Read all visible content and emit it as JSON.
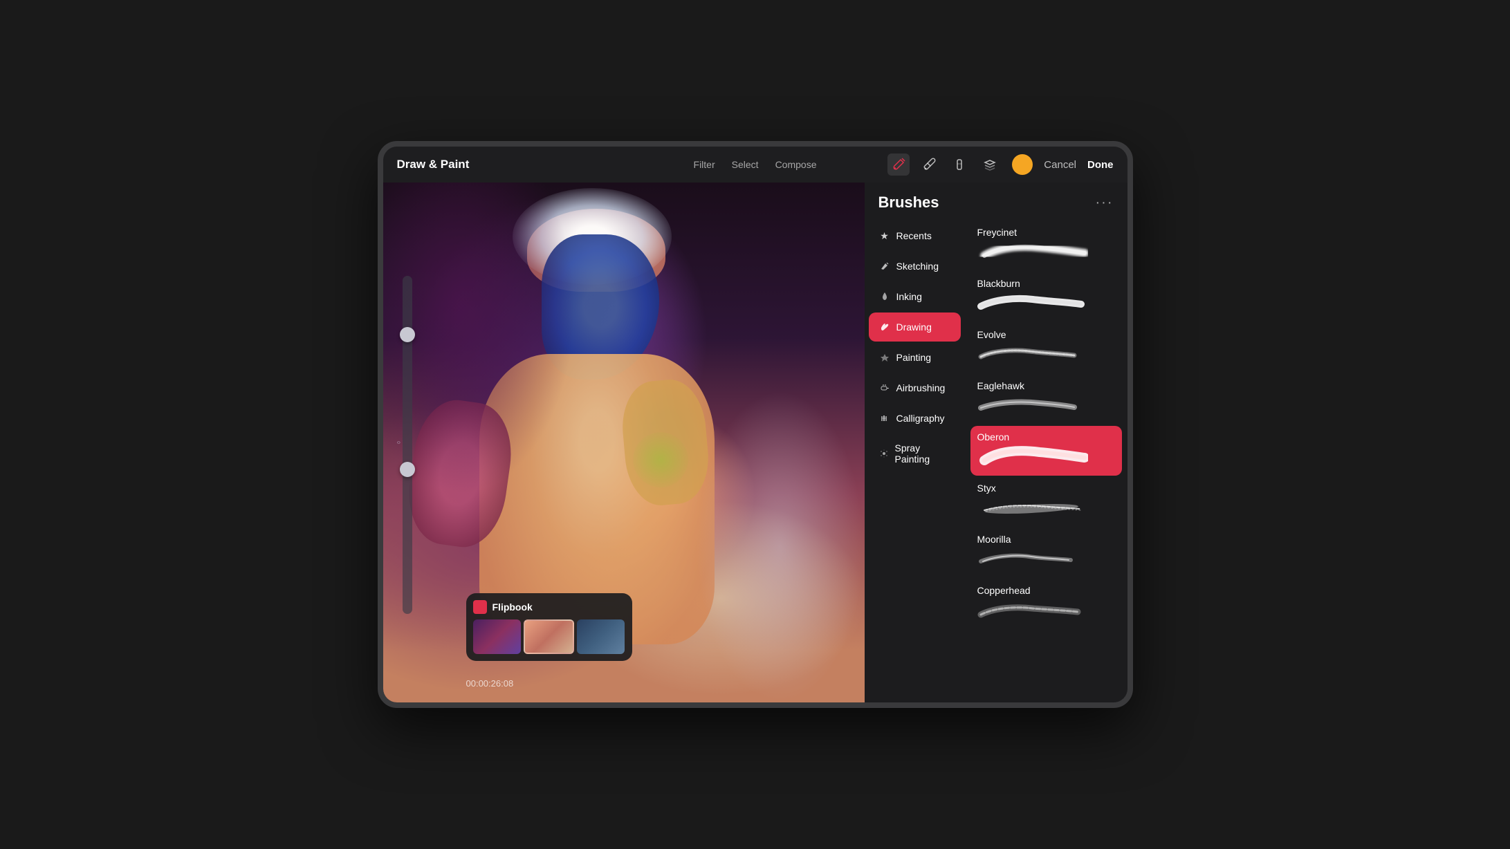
{
  "app": {
    "title": "Draw & Paint",
    "cancel_label": "Cancel",
    "done_label": "Done"
  },
  "toolbar": {
    "nav_items": [
      "Filter",
      "Select",
      "Compose"
    ],
    "tools": [
      "brush-tool",
      "eyedropper-tool",
      "pencil-tool",
      "layers-tool"
    ]
  },
  "canvas": {
    "timestamp": "00:00:26:08"
  },
  "flipbook": {
    "title": "Flipbook",
    "icon_color": "#e0304a"
  },
  "brushes": {
    "title": "Brushes",
    "more_label": "···",
    "categories": [
      {
        "id": "recents",
        "label": "Recents",
        "icon": "★",
        "active": false
      },
      {
        "id": "sketching",
        "label": "Sketching",
        "icon": "✏",
        "active": false
      },
      {
        "id": "inking",
        "label": "Inking",
        "icon": "💧",
        "active": false
      },
      {
        "id": "drawing",
        "label": "Drawing",
        "icon": "✦",
        "active": true
      },
      {
        "id": "painting",
        "label": "Painting",
        "icon": "◆",
        "active": false
      },
      {
        "id": "airbrushing",
        "label": "Airbrushing",
        "icon": "≋",
        "active": false
      },
      {
        "id": "calligraphy",
        "label": "Calligraphy",
        "icon": "|||",
        "active": false
      },
      {
        "id": "spray-painting",
        "label": "Spray Painting",
        "icon": "✳",
        "active": false
      }
    ],
    "brushes": [
      {
        "id": "freycinet",
        "name": "Freycinet",
        "selected": false
      },
      {
        "id": "blackburn",
        "name": "Blackburn",
        "selected": false
      },
      {
        "id": "evolve",
        "name": "Evolve",
        "selected": false
      },
      {
        "id": "eaglehawk",
        "name": "Eaglehawk",
        "selected": false
      },
      {
        "id": "oberon",
        "name": "Oberon",
        "selected": true
      },
      {
        "id": "styx",
        "name": "Styx",
        "selected": false
      },
      {
        "id": "moorilla",
        "name": "Moorilla",
        "selected": false
      },
      {
        "id": "copperhead",
        "name": "Copperhead",
        "selected": false
      }
    ]
  }
}
